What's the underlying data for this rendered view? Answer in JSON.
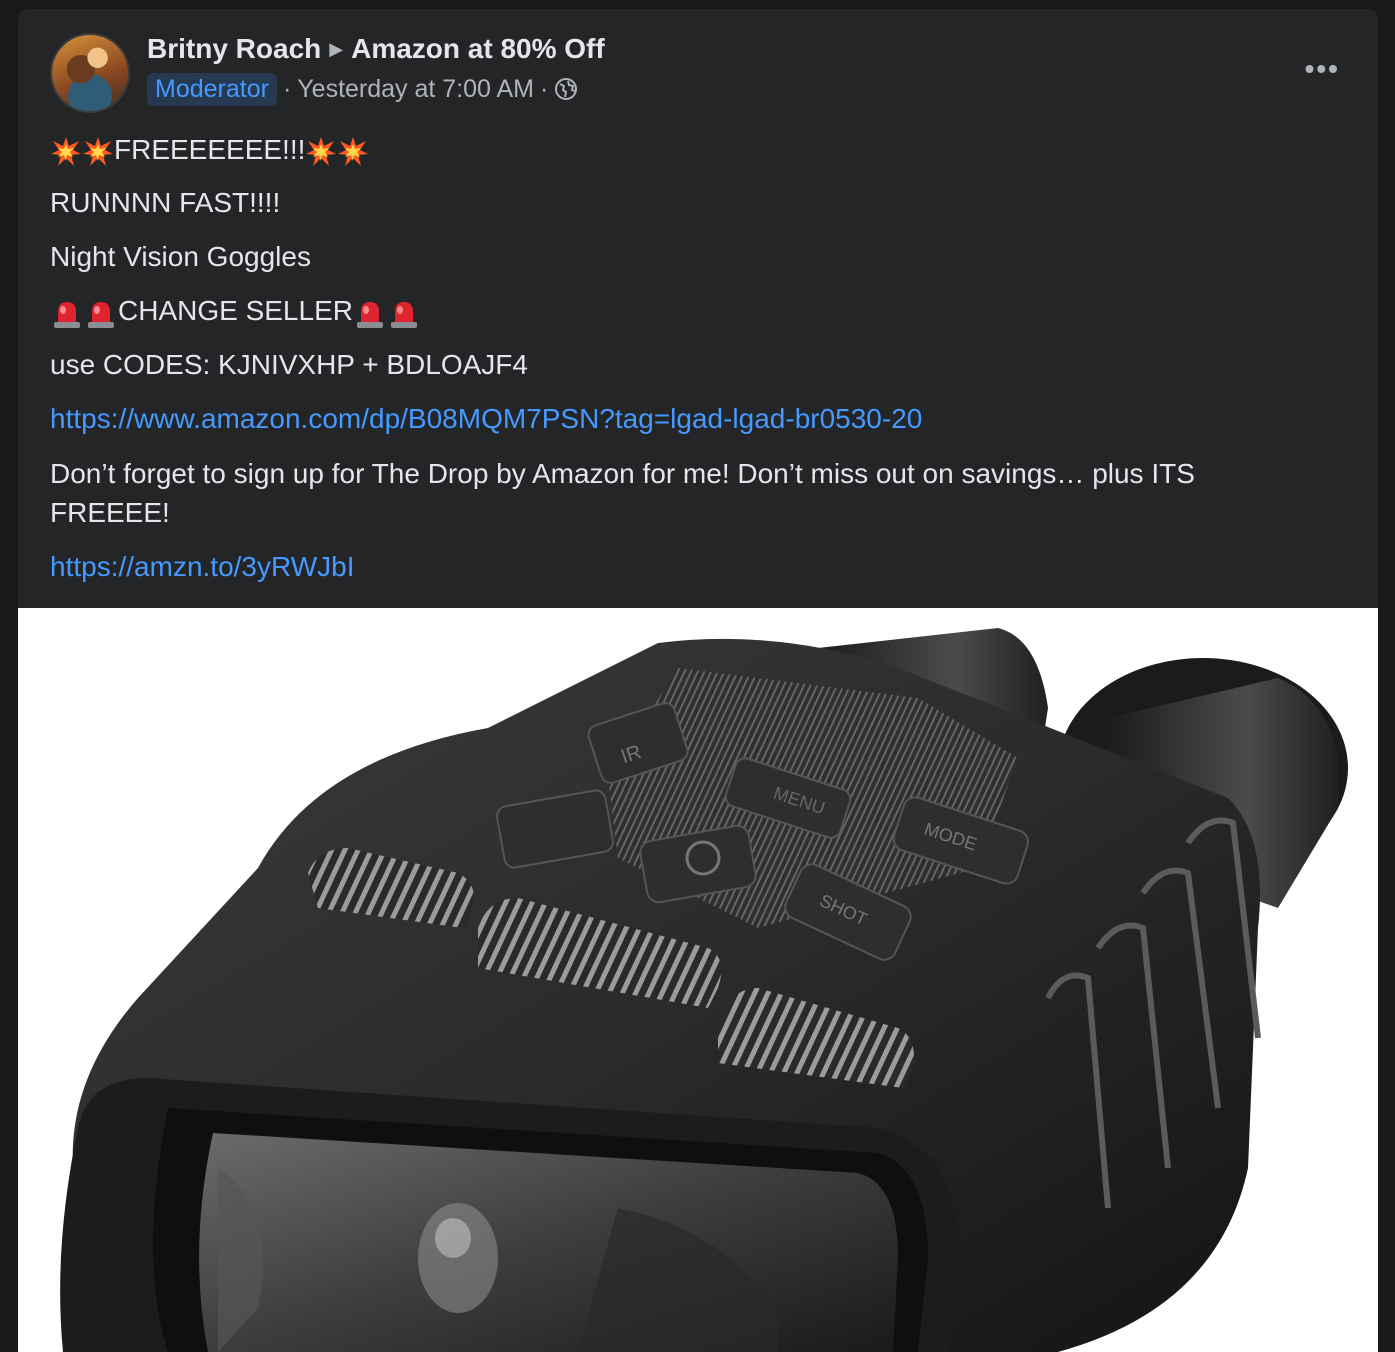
{
  "post": {
    "author": "Britny Roach",
    "group": "Amazon at 80% Off",
    "role_badge": "Moderator",
    "timestamp": "Yesterday at 7:00 AM",
    "separator": "·",
    "more_label": "•••",
    "privacy_icon": "globe-icon",
    "lines": {
      "line1_text": "FREEEEEEE!!!",
      "line2": "RUNNNN FAST!!!!",
      "line3": "Night Vision Goggles",
      "line4_text": "CHANGE SELLER",
      "line5": "use CODES: KJNIVXHP + BDLOAJF4",
      "link1": "https://www.amazon.com/dp/B08MQM7PSN?tag=lgad-lgad-br0530-20",
      "line6": "Don’t forget to sign up for The Drop by Amazon for me! Don’t miss out on savings… plus ITS FREEEE!",
      "link2": "https://amzn.to/3yRWJbI"
    },
    "emoji": {
      "collision": "collision-emoji",
      "siren": "police-light-emoji"
    },
    "image": {
      "subject": "night vision binoculars",
      "button_labels": [
        "MENU",
        "MODE",
        "SHOT",
        "IR"
      ]
    }
  },
  "colors": {
    "page_bg": "#18191a",
    "card_bg": "#242526",
    "text": "#e4e6eb",
    "muted": "#b0b3b8",
    "link": "#4599ff",
    "badge_bg": "#263951"
  }
}
